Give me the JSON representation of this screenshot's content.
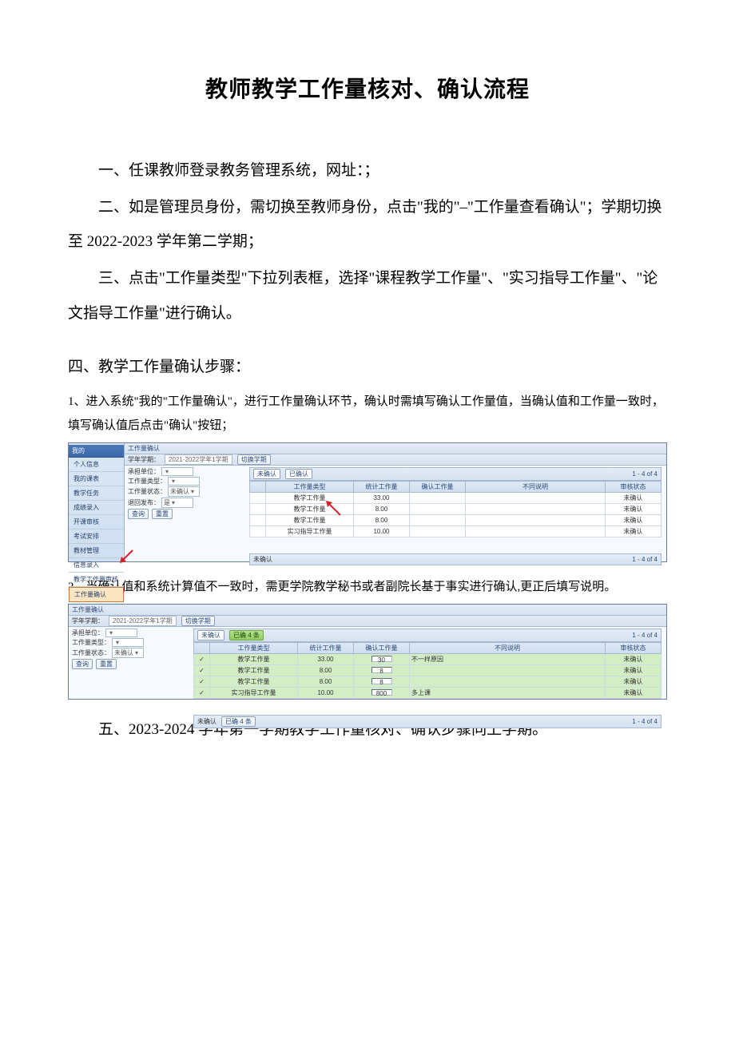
{
  "title": "教师教学工作量核对、确认流程",
  "paras": {
    "p1": "一、任课教师登录教务管理系统，网址：；",
    "p2": "二、如是管理员身份，需切换至教师身份，点击\"我的\"–\"工作量查看确认\"；学期切换至 2022-2023 学年第二学期；",
    "p3": "三、点击\"工作量类型\"下拉列表框，选择\"课程教学工作量\"、\"实习指导工作量\"、\"论文指导工作量\"进行确认。"
  },
  "section4": {
    "heading": "四、教学工作量确认步骤：",
    "step1": "1、进入系统\"我的\"工作量确认\"，进行工作量确认环节，确认时需填写确认工作量值，当确认值和工作量一致时，填写确认值后点击\"确认\"按钮；",
    "step2": "2、当确认值和系统计算值不一致时，需更学院教学秘书或者副院长基于事实进行确认,更正后填写说明。"
  },
  "section5": "五、2023-2024 学年第一学期教学工作量核对、确认步骤同上学期。",
  "shot1": {
    "nav": {
      "header": "我的",
      "items": [
        "个人信息",
        "我的课表",
        "教学任务",
        "成绩录入",
        "开课审核",
        "考试安排",
        "教材管理",
        "信息录入",
        "教学工作量审核"
      ],
      "highlight": "工作量确认"
    },
    "tab": {
      "title": "工作量确认",
      "term_label": "学年学期：",
      "term_value": "2021-2022学年1学期",
      "switch_btn": "切换学期"
    },
    "filters": {
      "dept_label": "承担单位：",
      "dept_value": "",
      "type_label": "工作量类型：",
      "type_value": "",
      "state_label": "工作量状态：",
      "state_value": "未确认",
      "ret_label": "退回发布：",
      "ret_value": "是",
      "query_btn": "查询",
      "reset_btn": "重置"
    },
    "header": {
      "tab_unconfirm": "未确认",
      "tab_confirmed": "已确认",
      "pager": "1 - 4 of 4"
    },
    "cols": [
      "",
      "工作量类型",
      "统计工作量",
      "确认工作量",
      "不同说明",
      "审核状态"
    ],
    "rows": [
      {
        "c0": "",
        "type": "教学工作量",
        "stat": "33.00",
        "conf": "",
        "note": "",
        "state": "未确认"
      },
      {
        "c0": "",
        "type": "教学工作量",
        "stat": "8.00",
        "conf": "",
        "note": "",
        "state": "未确认"
      },
      {
        "c0": "",
        "type": "教学工作量",
        "stat": "8.00",
        "conf": "",
        "note": "",
        "state": "未确认"
      },
      {
        "c0": "",
        "type": "实习指导工作量",
        "stat": "10.00",
        "conf": "",
        "note": "",
        "state": "未确认"
      }
    ],
    "footer": {
      "tab": "未确认",
      "pager": "1 - 4 of 4"
    }
  },
  "shot2": {
    "tab": {
      "title": "工作量确认",
      "term_label": "学年学期：",
      "term_value": "2021-2022学年1学期",
      "switch_btn": "切换学期"
    },
    "filters": {
      "dept_label": "承担单位：",
      "dept_value": "",
      "type_label": "工作量类型：",
      "type_value": "",
      "state_label": "工作量状态：",
      "state_value": "未确认",
      "query_btn": "查询",
      "reset_btn": "重置"
    },
    "header": {
      "tab_unconfirm": "未确认",
      "tab_confirmed": "已确 4 条",
      "pager": "1 - 4 of 4"
    },
    "cols": [
      "",
      "工作量类型",
      "统计工作量",
      "确认工作量",
      "不同说明",
      "审核状态"
    ],
    "rows": [
      {
        "c0": "✓",
        "type": "教学工作量",
        "stat": "33.00",
        "conf": "30",
        "note": "不一样原因",
        "state": "未确认",
        "green": true
      },
      {
        "c0": "✓",
        "type": "教学工作量",
        "stat": "8.00",
        "conf": "8",
        "note": "",
        "state": "未确认",
        "green": true
      },
      {
        "c0": "✓",
        "type": "教学工作量",
        "stat": "8.00",
        "conf": "8",
        "note": "",
        "state": "未确认",
        "green": true
      },
      {
        "c0": "✓",
        "type": "实习指导工作量",
        "stat": "10.00",
        "conf": "800",
        "note": "多上课",
        "state": "未确认",
        "green": true
      }
    ],
    "footer": {
      "tab": "未确认",
      "confirmed": "已确 4 条",
      "pager": "1 - 4 of 4"
    }
  }
}
